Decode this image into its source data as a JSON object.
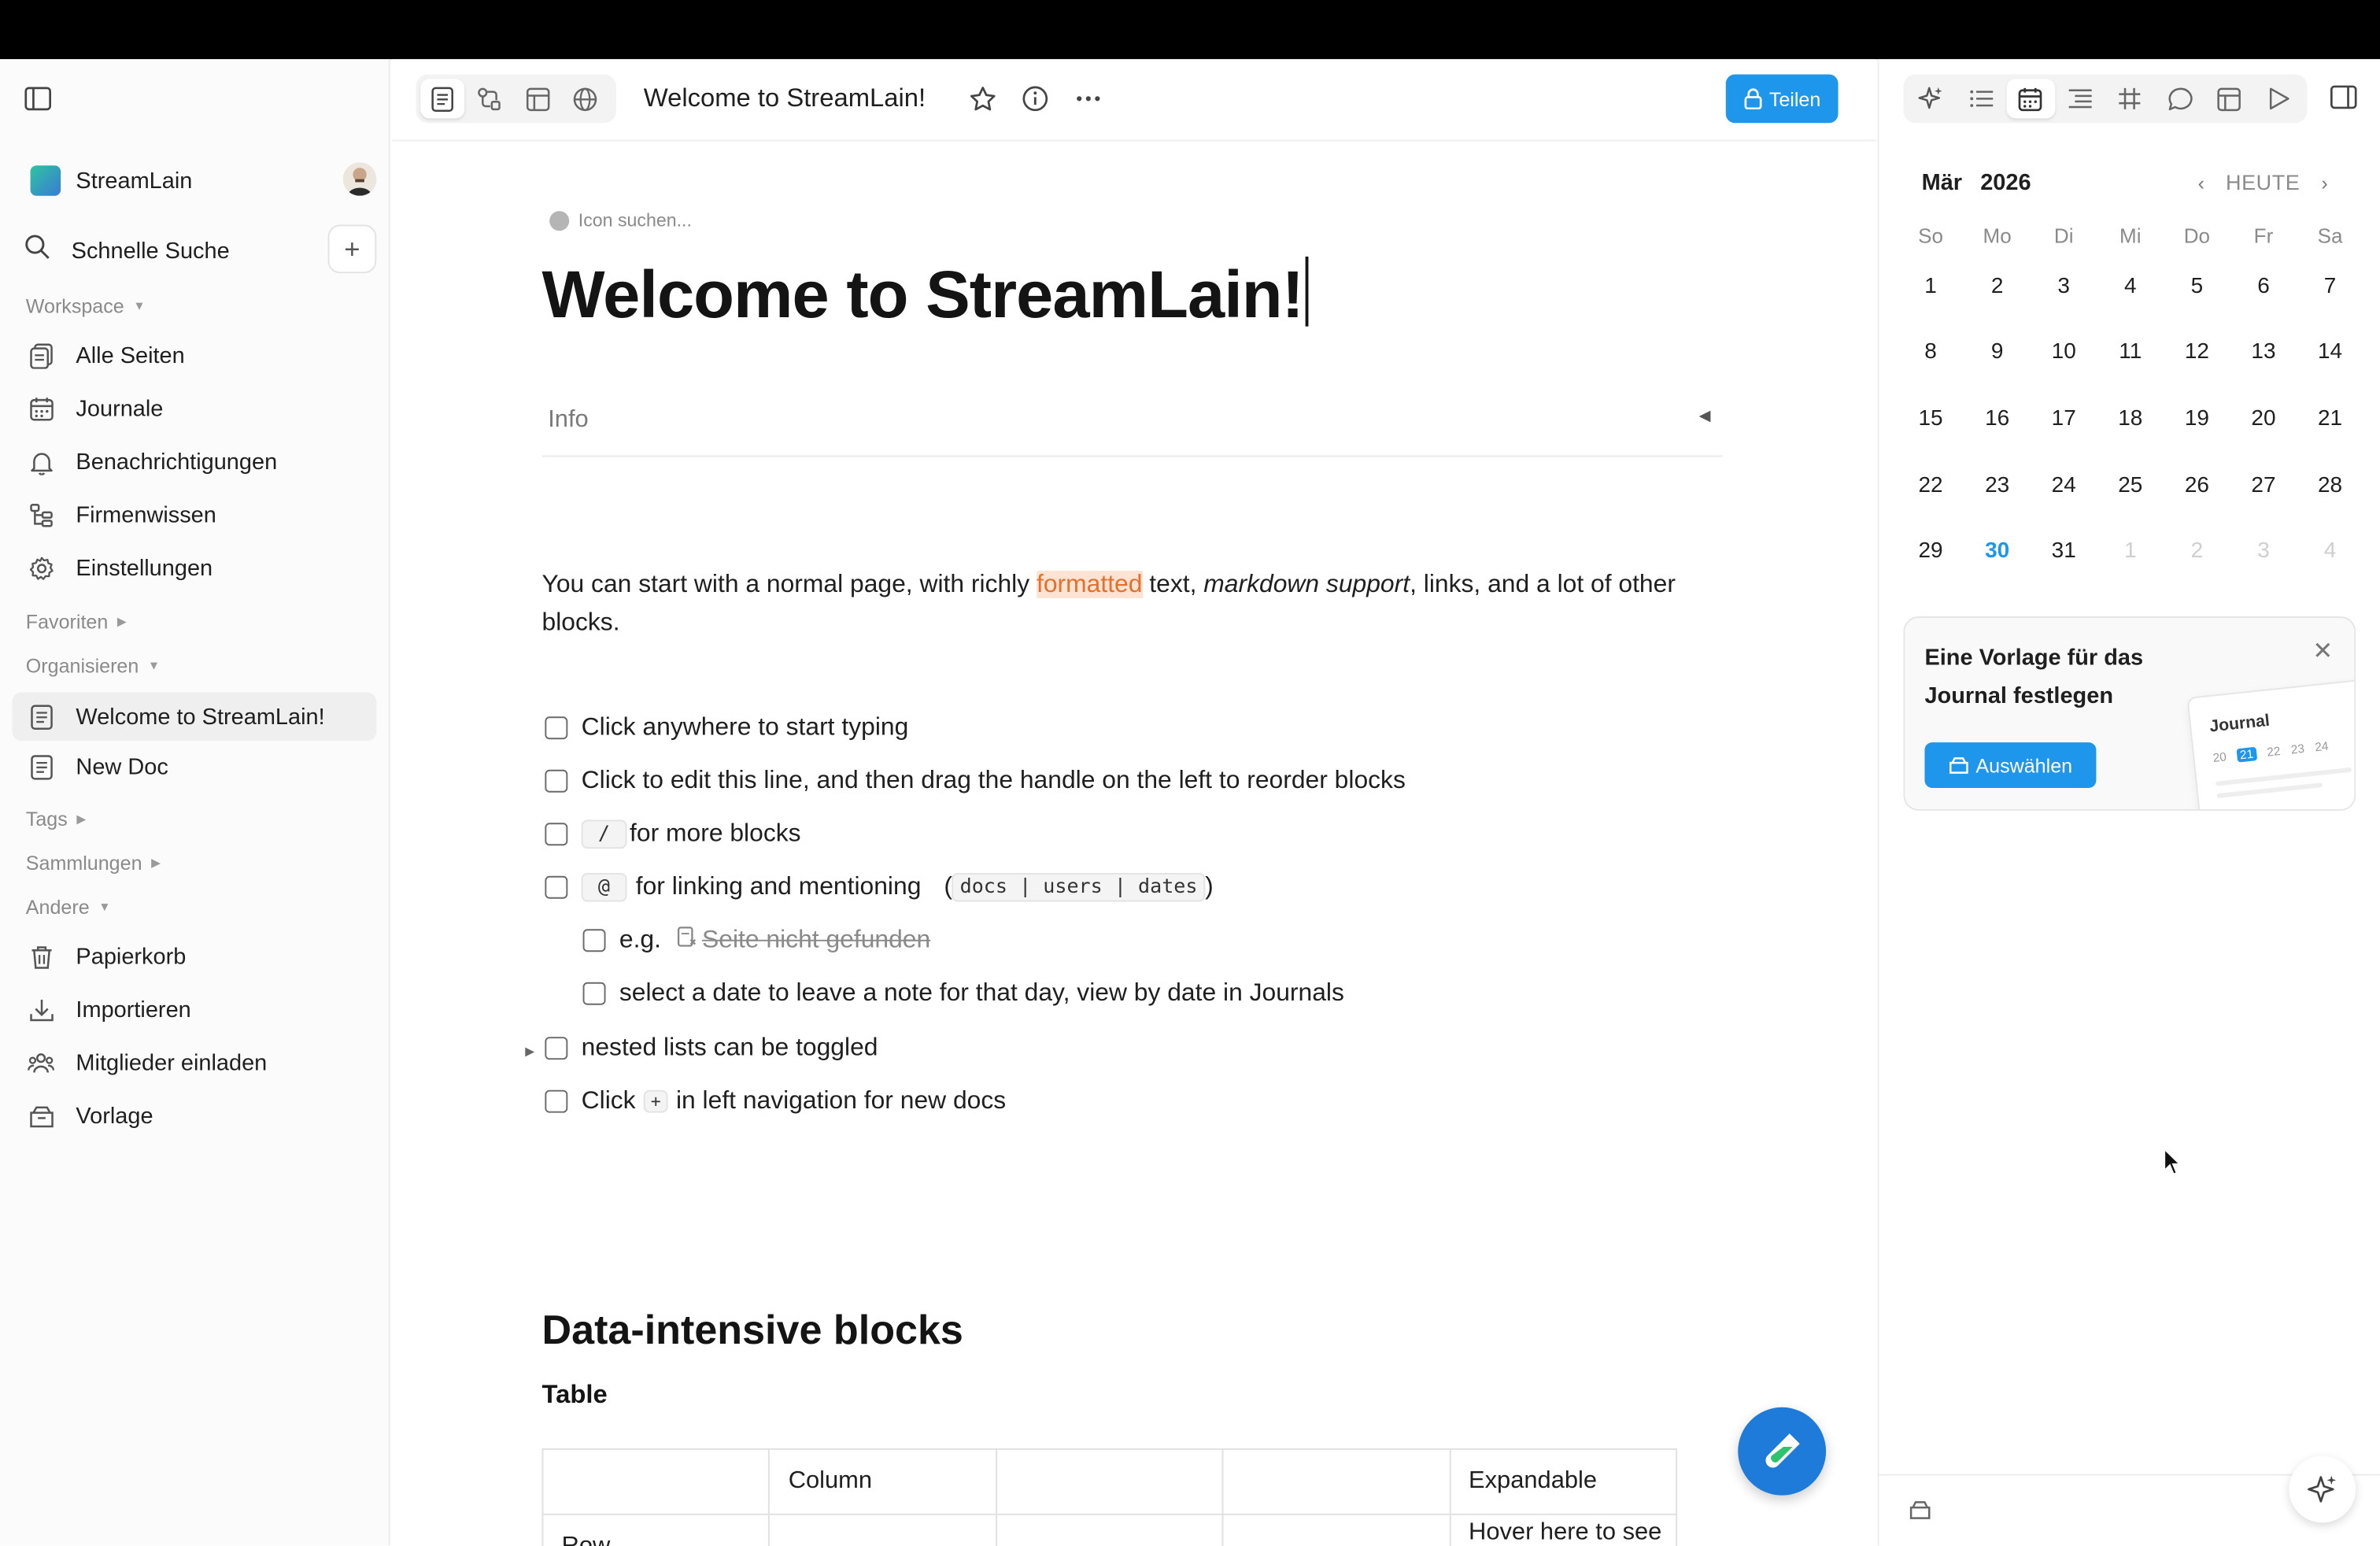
{
  "sidebar": {
    "workspace_name": "StreamLain",
    "search_label": "Schnelle Suche",
    "add_label": "+",
    "sections": {
      "workspace": "Workspace",
      "favorites": "Favoriten",
      "organize": "Organisieren",
      "tags": "Tags",
      "collections": "Sammlungen",
      "other": "Andere"
    },
    "items": {
      "all_pages": "Alle Seiten",
      "journals": "Journale",
      "notifications": "Benachrichtigungen",
      "company_knowledge": "Firmenwissen",
      "settings": "Einstellungen",
      "welcome_doc": "Welcome to StreamLain!",
      "new_doc": "New Doc",
      "trash": "Papierkorb",
      "import": "Importieren",
      "invite": "Mitglieder einladen",
      "template": "Vorlage"
    }
  },
  "header": {
    "title": "Welcome to StreamLain!",
    "share_label": "Teilen"
  },
  "doc": {
    "icon_search": "Icon suchen...",
    "title": "Welcome to StreamLain!",
    "info_label": "Info",
    "para": {
      "p1": "You can start with a normal page, with richly ",
      "highlight": "formatted",
      "p2": " text, ",
      "italic": "markdown support",
      "p3": ", links, and a lot of other blocks."
    },
    "todos": {
      "t1": "Click anywhere to start typing",
      "t2": "Click to edit this line, and then drag the handle on the left to reorder blocks",
      "t3_key": "/",
      "t3": "for more blocks",
      "t4_key": "@",
      "t4": "for linking and mentioning",
      "t4_paren_open": "(",
      "t4_code": "docs | users | dates",
      "t4_paren_close": ")",
      "t5": "e.g.",
      "t5_link": "Seite nicht gefunden",
      "t6": "select a date to leave a note for that day, view by date in Journals",
      "t7": "nested lists can be toggled",
      "t8a": "Click",
      "t8_key": "+",
      "t8b": "in left navigation for new docs"
    },
    "h2": "Data-intensive blocks",
    "h3": "Table",
    "table": {
      "r0": [
        "",
        "Column",
        "",
        "",
        "Expandable"
      ],
      "r1": [
        "Row",
        "",
        "",
        "",
        "Hover here to see drag"
      ]
    }
  },
  "calendar": {
    "month": "Mär",
    "year": "2026",
    "today_label": "HEUTE",
    "weekdays": [
      "So",
      "Mo",
      "Di",
      "Mi",
      "Do",
      "Fr",
      "Sa"
    ],
    "weeks": [
      [
        "1",
        "2",
        "3",
        "4",
        "5",
        "6",
        "7"
      ],
      [
        "8",
        "9",
        "10",
        "11",
        "12",
        "13",
        "14"
      ],
      [
        "15",
        "16",
        "17",
        "18",
        "19",
        "20",
        "21"
      ],
      [
        "22",
        "23",
        "24",
        "25",
        "26",
        "27",
        "28"
      ],
      [
        "29",
        "30",
        "31",
        "1",
        "2",
        "3",
        "4"
      ]
    ],
    "today": "30"
  },
  "template_card": {
    "title": "Eine Vorlage für das Journal festlegen",
    "button": "Auswählen",
    "preview_title": "Journal",
    "preview_days": [
      "20",
      "21",
      "22",
      "23",
      "24"
    ]
  },
  "colors": {
    "accent": "#1e96eb",
    "highlight_bg": "#fde3d3",
    "highlight_fg": "#e5702c"
  }
}
